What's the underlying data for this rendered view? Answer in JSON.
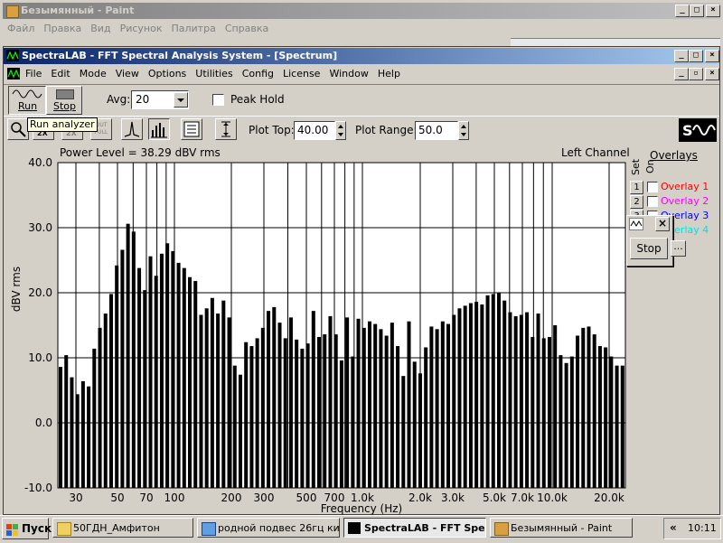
{
  "paint": {
    "title": "Безымянный - Paint",
    "menu": [
      "Файл",
      "Правка",
      "Вид",
      "Рисунок",
      "Палитра",
      "Справка"
    ]
  },
  "spectralab": {
    "title": "SpectraLAB - FFT Spectral Analysis System - [Spectrum]",
    "menu": [
      "File",
      "Edit",
      "Mode",
      "View",
      "Options",
      "Utilities",
      "Config",
      "License",
      "Window",
      "Help"
    ],
    "toolbar": {
      "run_label": "Run",
      "stop_label": "Stop",
      "avg_label": "Avg:",
      "avg_value": "20",
      "peak_hold_label": "Peak Hold",
      "tooltip": "Run analyzer",
      "plot_top_label": "Plot Top:",
      "plot_top_value": "40.00",
      "plot_range_label": "Plot Range:",
      "plot_range_value": "50.0"
    },
    "plot_header": {
      "power_level": "Power Level = 38.29 dBV rms",
      "channel": "Left Channel"
    },
    "overlays": {
      "title": "Overlays",
      "col_set": "Set",
      "col_on": "On",
      "items": [
        {
          "num": "1",
          "label": "Overlay 1",
          "color": "#ff0000"
        },
        {
          "num": "2",
          "label": "Overlay 2",
          "color": "#ff00ff"
        },
        {
          "num": "3",
          "label": "Overlay 3",
          "color": "#0000ff"
        },
        {
          "num": "4",
          "label": "Overlay 4",
          "color": "#00e0e0"
        }
      ],
      "more_button": "..."
    },
    "mini_window": {
      "stop_label": "Stop"
    }
  },
  "chart_data": {
    "type": "bar",
    "ylabel": "dBV rms",
    "xlabel": "Frequency (Hz)",
    "ylim": [
      -10,
      40
    ],
    "yticks": [
      "40.0",
      "30.0",
      "20.0",
      "10.0",
      "0.0",
      "-10.0"
    ],
    "xscale": "log",
    "xlim": [
      20,
      25000
    ],
    "xticks": [
      {
        "label": "30",
        "value": 30
      },
      {
        "label": "50",
        "value": 50
      },
      {
        "label": "70",
        "value": 70
      },
      {
        "label": "100",
        "value": 100
      },
      {
        "label": "200",
        "value": 200
      },
      {
        "label": "300",
        "value": 300
      },
      {
        "label": "500",
        "value": 500
      },
      {
        "label": "700",
        "value": 700
      },
      {
        "label": "1.0k",
        "value": 1000
      },
      {
        "label": "2.0k",
        "value": 2000
      },
      {
        "label": "3.0k",
        "value": 3000
      },
      {
        "label": "5.0k",
        "value": 5000
      },
      {
        "label": "7.0k",
        "value": 7000
      },
      {
        "label": "10.0k",
        "value": 10000
      },
      {
        "label": "20.0k",
        "value": 20000
      }
    ],
    "grid": true,
    "values": [
      8.6,
      10.4,
      7.0,
      4.4,
      6.4,
      5.6,
      11.4,
      14.6,
      16.8,
      19.8,
      24.2,
      26.6,
      30.6,
      29.4,
      23.8,
      20.4,
      25.6,
      22.6,
      26.0,
      27.6,
      26.4,
      24.6,
      23.8,
      22.4,
      21.8,
      16.6,
      17.6,
      19.2,
      16.8,
      18.8,
      16.2,
      8.8,
      7.4,
      12.4,
      11.8,
      13.0,
      14.6,
      17.2,
      17.8,
      15.4,
      13.0,
      16.2,
      12.8,
      11.4,
      12.2,
      17.2,
      13.2,
      13.6,
      16.4,
      13.6,
      9.6,
      16.2,
      10.2,
      16.0,
      14.6,
      15.6,
      15.2,
      14.4,
      13.4,
      15.4,
      11.8,
      7.2,
      15.6,
      9.4,
      7.6,
      11.6,
      14.8,
      14.4,
      15.6,
      15.2,
      16.6,
      17.6,
      18.0,
      18.4,
      18.6,
      18.2,
      19.6,
      19.8,
      20.0,
      18.8,
      17.0,
      16.4,
      16.6,
      17.0,
      13.2,
      16.8,
      13.0,
      13.2,
      15.0,
      10.4,
      9.2,
      10.2,
      13.4,
      14.6,
      14.8,
      13.6,
      11.8,
      11.6,
      10.2,
      8.8,
      8.8
    ]
  }
}
